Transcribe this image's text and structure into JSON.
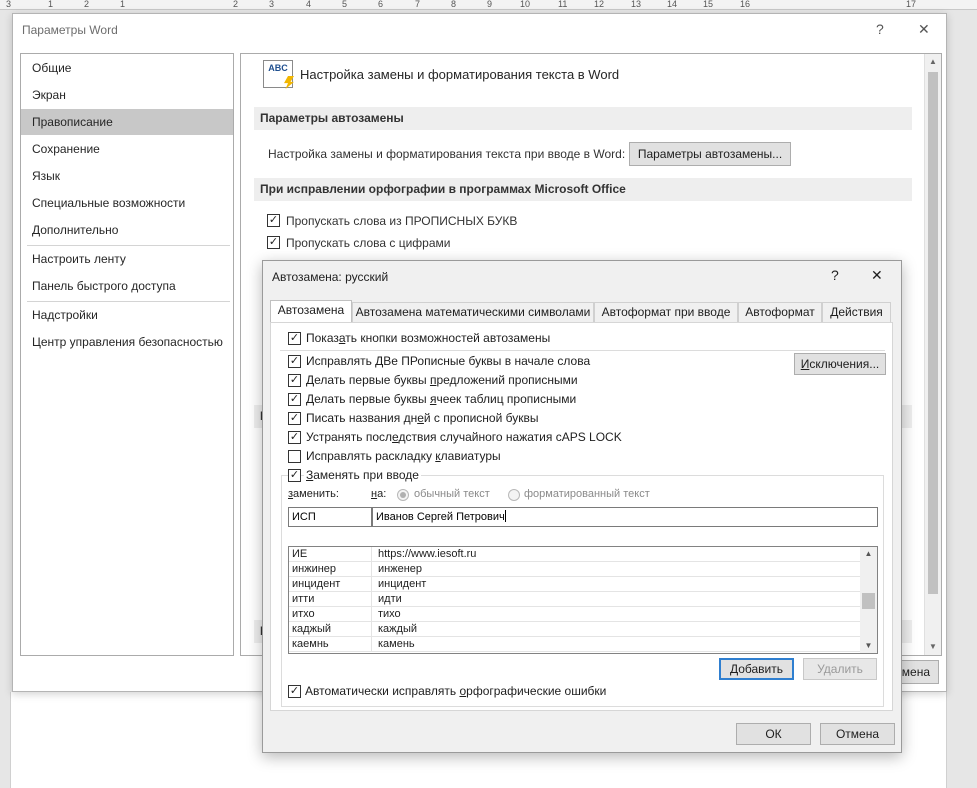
{
  "ruler": {
    "nums": [
      {
        "t": "3",
        "k": 6
      },
      {
        "t": "1",
        "k": 48
      },
      {
        "t": "2",
        "k": 84
      },
      {
        "t": "1",
        "k": 120
      },
      {
        "t": "2",
        "k": 233
      },
      {
        "t": "3",
        "k": 269
      },
      {
        "t": "4",
        "k": 306
      },
      {
        "t": "5",
        "k": 342
      },
      {
        "t": "6",
        "k": 378
      },
      {
        "t": "7",
        "k": 415
      },
      {
        "t": "8",
        "k": 451
      },
      {
        "t": "9",
        "k": 487
      },
      {
        "t": "10",
        "k": 520
      },
      {
        "t": "11",
        "k": 558
      },
      {
        "t": "12",
        "k": 594
      },
      {
        "t": "13",
        "k": 631
      },
      {
        "t": "14",
        "k": 667
      },
      {
        "t": "15",
        "k": 703
      },
      {
        "t": "16",
        "k": 740
      },
      {
        "t": "17",
        "k": 906
      }
    ]
  },
  "options": {
    "title": "Параметры Word",
    "help": "?",
    "close": "✕",
    "nav": [
      "Общие",
      "Экран",
      "Правописание",
      "Сохранение",
      "Язык",
      "Специальные возможности",
      "Дополнительно",
      "Настроить ленту",
      "Панель быстрого доступа",
      "Надстройки",
      "Центр управления безопасностью"
    ],
    "selected_nav": "Правописание",
    "header": "Настройка замены и форматирования текста в Word",
    "icon_text": "ABC",
    "section1": "Параметры автозамены",
    "autocorrect_row": "Настройка замены и форматирования текста при вводе в Word:",
    "autocorrect_button": "Параметры автозамены...",
    "section2": "При исправлении орфографии в программах Microsoft Office",
    "check1": "Пропускать слова из ПРОПИСНЫХ БУКВ",
    "check2": "Пропускать слова с цифрами",
    "partial_section_a": "П",
    "partial_section_b": "И",
    "partial_cancel": "мена",
    "check_mark": "✓"
  },
  "autocorrect": {
    "title": "Автозамена: русский",
    "help": "?",
    "close": "✕",
    "tabs": [
      "Автозамена",
      "Автозамена математическими символами",
      "Автоформат при вводе",
      "Автоформат",
      "Действия"
    ],
    "show_buttons": {
      "a": "Показ",
      "u": "а",
      "b": "ть кнопки возможностей автозамены"
    },
    "exceptions_button": {
      "a": "",
      "u": "И",
      "b": "сключения..."
    },
    "options": [
      {
        "a": "Исправлять ",
        "u": "Д",
        "b": "Ве ПРописные буквы в начале слова",
        "checked": true
      },
      {
        "a": "Делать первые буквы ",
        "u": "п",
        "b": "редложений прописными",
        "checked": true
      },
      {
        "a": "Делать первые буквы ",
        "u": "я",
        "b": "чеек таблиц прописными",
        "checked": true
      },
      {
        "a": "Писать названия дн",
        "u": "е",
        "b": "й с прописной буквы",
        "checked": true
      },
      {
        "a": "Устранять посл",
        "u": "е",
        "b": "дствия случайного нажатия cAPS LOCK",
        "checked": true
      },
      {
        "a": "Исправлять раскладку ",
        "u": "к",
        "b": "лавиатуры",
        "checked": false
      }
    ],
    "replace_group": {
      "a": "",
      "u": "З",
      "b": "аменять при вводе",
      "checked": true
    },
    "replace_label": {
      "a": "",
      "u": "з",
      "b": "аменить:"
    },
    "with_label": {
      "a": "",
      "u": "н",
      "b": "а:"
    },
    "radio_plain": "обычный текст",
    "radio_formatted": "форматированный текст",
    "replace_value": "ИСП",
    "with_value": "Иванов Сергей Петрович",
    "entries": [
      {
        "from": "ИЕ",
        "to": "https://www.iesoft.ru"
      },
      {
        "from": "инжинер",
        "to": "инженер"
      },
      {
        "from": "инцидент",
        "to": "инцидент"
      },
      {
        "from": "итти",
        "to": "идти"
      },
      {
        "from": "итхо",
        "to": "тихо"
      },
      {
        "from": "каджый",
        "to": "каждый"
      },
      {
        "from": "каемнь",
        "to": "камень"
      }
    ],
    "add_button": {
      "a": "",
      "u": "Д",
      "b": "обавить"
    },
    "delete_button": "Удалить",
    "auto_spell": {
      "a": "Автоматически исправлять ",
      "u": "о",
      "b": "рфографические ошибки",
      "checked": true
    },
    "ok": "ОК",
    "cancel": "Отмена"
  }
}
